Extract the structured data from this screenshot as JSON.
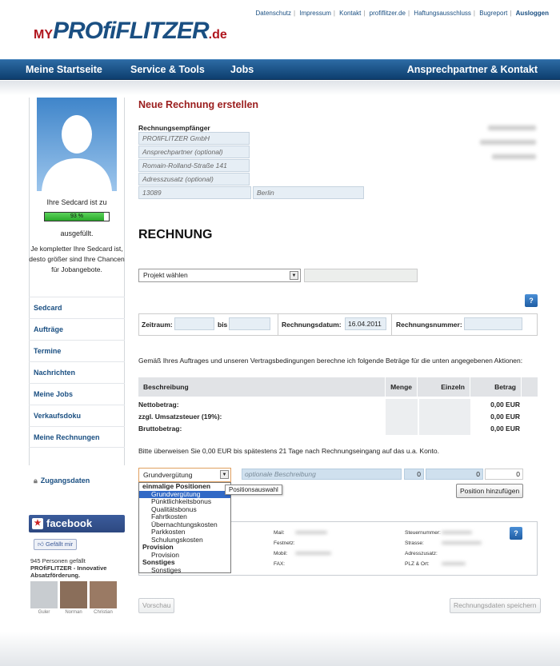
{
  "header": {
    "logo": {
      "my": "MY",
      "name": "PROfiFLITZER",
      "tld": ".de"
    },
    "top_links": [
      "Datenschutz",
      "Impressum",
      "Kontakt",
      "profiflitzer.de",
      "Haftungsausschluss",
      "Bugreport"
    ],
    "logout": "Ausloggen"
  },
  "nav": {
    "home": "Meine Startseite",
    "service": "Service & Tools",
    "jobs": "Jobs",
    "contact": "Ansprechpartner & Kontakt"
  },
  "sidebar": {
    "sedcard_line1": "Ihre Sedcard ist zu",
    "progress_label": "93 %",
    "progress_value": 0.93,
    "sedcard_line2": "ausgefüllt.",
    "hint": "Je kompletter Ihre Sedcard ist, desto größer sind Ihre Chancen für Jobangebote.",
    "items": [
      {
        "label": "Sedcard"
      },
      {
        "label": "Aufträge"
      },
      {
        "label": "Termine"
      },
      {
        "label": "Nachrichten"
      },
      {
        "label": "Meine Jobs"
      },
      {
        "label": "Verkaufsdoku"
      },
      {
        "label": "Meine Rechnungen"
      }
    ],
    "zugang": "Zugangsdaten"
  },
  "facebook": {
    "brand": "facebook",
    "like": "Gefällt mir",
    "count": "945 Personen gefällt",
    "page_name": "PROfiFLITZER - Innovative Absatzförderung.",
    "faces": [
      "Guler",
      "Norman",
      "Christian"
    ]
  },
  "invoice": {
    "title": "Neue Rechnung erstellen",
    "recipient_label": "Rechnungsempfänger",
    "recipient": {
      "company": "PROfiFLITZER GmbH",
      "contact": "Ansprechpartner (optional)",
      "street": "Romain-Rolland-Straße 141",
      "extra": "Adresszusatz (optional)",
      "zip": "13089",
      "city": "Berlin"
    },
    "heading": "RECHNUNG",
    "project_select": "Projekt wählen",
    "help": "?",
    "zeitraum_label": "Zeitraum:",
    "bis_label": "bis",
    "date_label": "Rechnungsdatum:",
    "date_value": "16.04.2011",
    "number_label": "Rechnungsnummer:",
    "terms": "Gemäß Ihres Auftrages und unseren Vertragsbedingungen berechne ich folgende Beträge für die unten angegebenen Aktionen:",
    "columns": [
      "Beschreibung",
      "Menge",
      "Einzeln",
      "Betrag"
    ],
    "sums": [
      {
        "label": "Nettobetrag:",
        "value": "0,00 EUR"
      },
      {
        "label": "zzgl. Umsatzsteuer (19%):",
        "value": "0,00 EUR"
      },
      {
        "label": "Bruttobetrag:",
        "value": "0,00 EUR"
      }
    ],
    "transfer_note": "Bitte überweisen Sie 0,00 EUR bis spätestens 21 Tage nach Rechnungseingang auf das u.a. Konto.",
    "position_select": "Grundvergütung",
    "position_desc_placeholder": "optionale Beschreibung",
    "qty": "0",
    "single": "0",
    "total": "0",
    "add_position": "Position hinzufügen",
    "tooltip": "Positionsauswahl",
    "dropdown": [
      {
        "group": "einmalige Positionen",
        "options": [
          "Grundvergütung",
          "Pünktlichkeitsbonus",
          "Qualitätsbonus",
          "Fahrtkosten",
          "Übernachtungskosten",
          "Parkkosten",
          "Schulungskosten"
        ]
      },
      {
        "group": "Provision",
        "options": [
          "Provision"
        ]
      },
      {
        "group": "Sonstiges",
        "options": [
          "Sonstiges"
        ]
      }
    ],
    "contact_labels": {
      "mail": "Mail:",
      "festnetz": "Festnetz:",
      "mobil": "Mobil:",
      "fax": "FAX:",
      "steuer": "Steuernummer:",
      "strasse": "Strasse:",
      "adresszusatz": "Adresszusatz:",
      "plz": "PLZ & Ort:"
    },
    "back": "Vorschau",
    "save": "Rechnungsdaten speichern"
  }
}
